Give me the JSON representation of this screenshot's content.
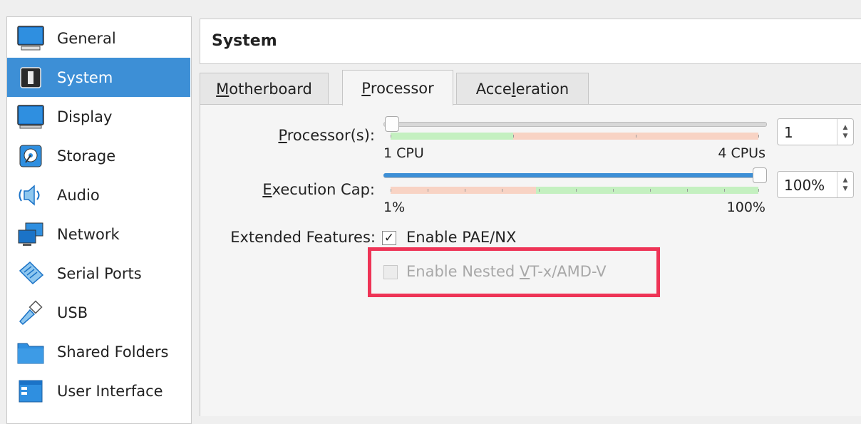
{
  "sidebar": {
    "items": [
      {
        "label": "General",
        "icon": "general-monitor-icon"
      },
      {
        "label": "System",
        "icon": "system-chip-icon",
        "selected": true
      },
      {
        "label": "Display",
        "icon": "display-monitor-icon"
      },
      {
        "label": "Storage",
        "icon": "storage-disk-icon"
      },
      {
        "label": "Audio",
        "icon": "speaker-icon"
      },
      {
        "label": "Network",
        "icon": "network-icon"
      },
      {
        "label": "Serial Ports",
        "icon": "serial-port-icon"
      },
      {
        "label": "USB",
        "icon": "usb-icon"
      },
      {
        "label": "Shared Folders",
        "icon": "folder-icon"
      },
      {
        "label": "User Interface",
        "icon": "user-interface-icon"
      }
    ]
  },
  "header": {
    "title": "System"
  },
  "tabs": [
    {
      "label_u": "M",
      "label_rest": "otherboard"
    },
    {
      "label_u": "P",
      "label_rest": "rocessor",
      "active": true
    },
    {
      "label_pre": "Acce",
      "label_u": "l",
      "label_rest": "eration"
    }
  ],
  "processor": {
    "label_u": "P",
    "label_rest": "rocessor(s):",
    "min_label": "1 CPU",
    "max_label": "4 CPUs",
    "value": "1",
    "level": 0.0
  },
  "execution_cap": {
    "label_u": "E",
    "label_rest": "xecution Cap:",
    "min_label": "1%",
    "max_label": "100%",
    "value": "100%",
    "level": 1.0
  },
  "extended_features": {
    "label": "Extended Features:",
    "pae": {
      "check": "✓",
      "label": "Enable PAE/NX",
      "checked": true
    },
    "nested": {
      "label_pre": "Enable Nested ",
      "label_u": "V",
      "label_rest": "T-x/AMD-V",
      "checked": false,
      "disabled": true
    }
  },
  "colors": {
    "accent": "#3d8fd6",
    "highlight": "#ee3456",
    "green_band": "#c4f0c0",
    "red_band": "#f8d3c4"
  }
}
